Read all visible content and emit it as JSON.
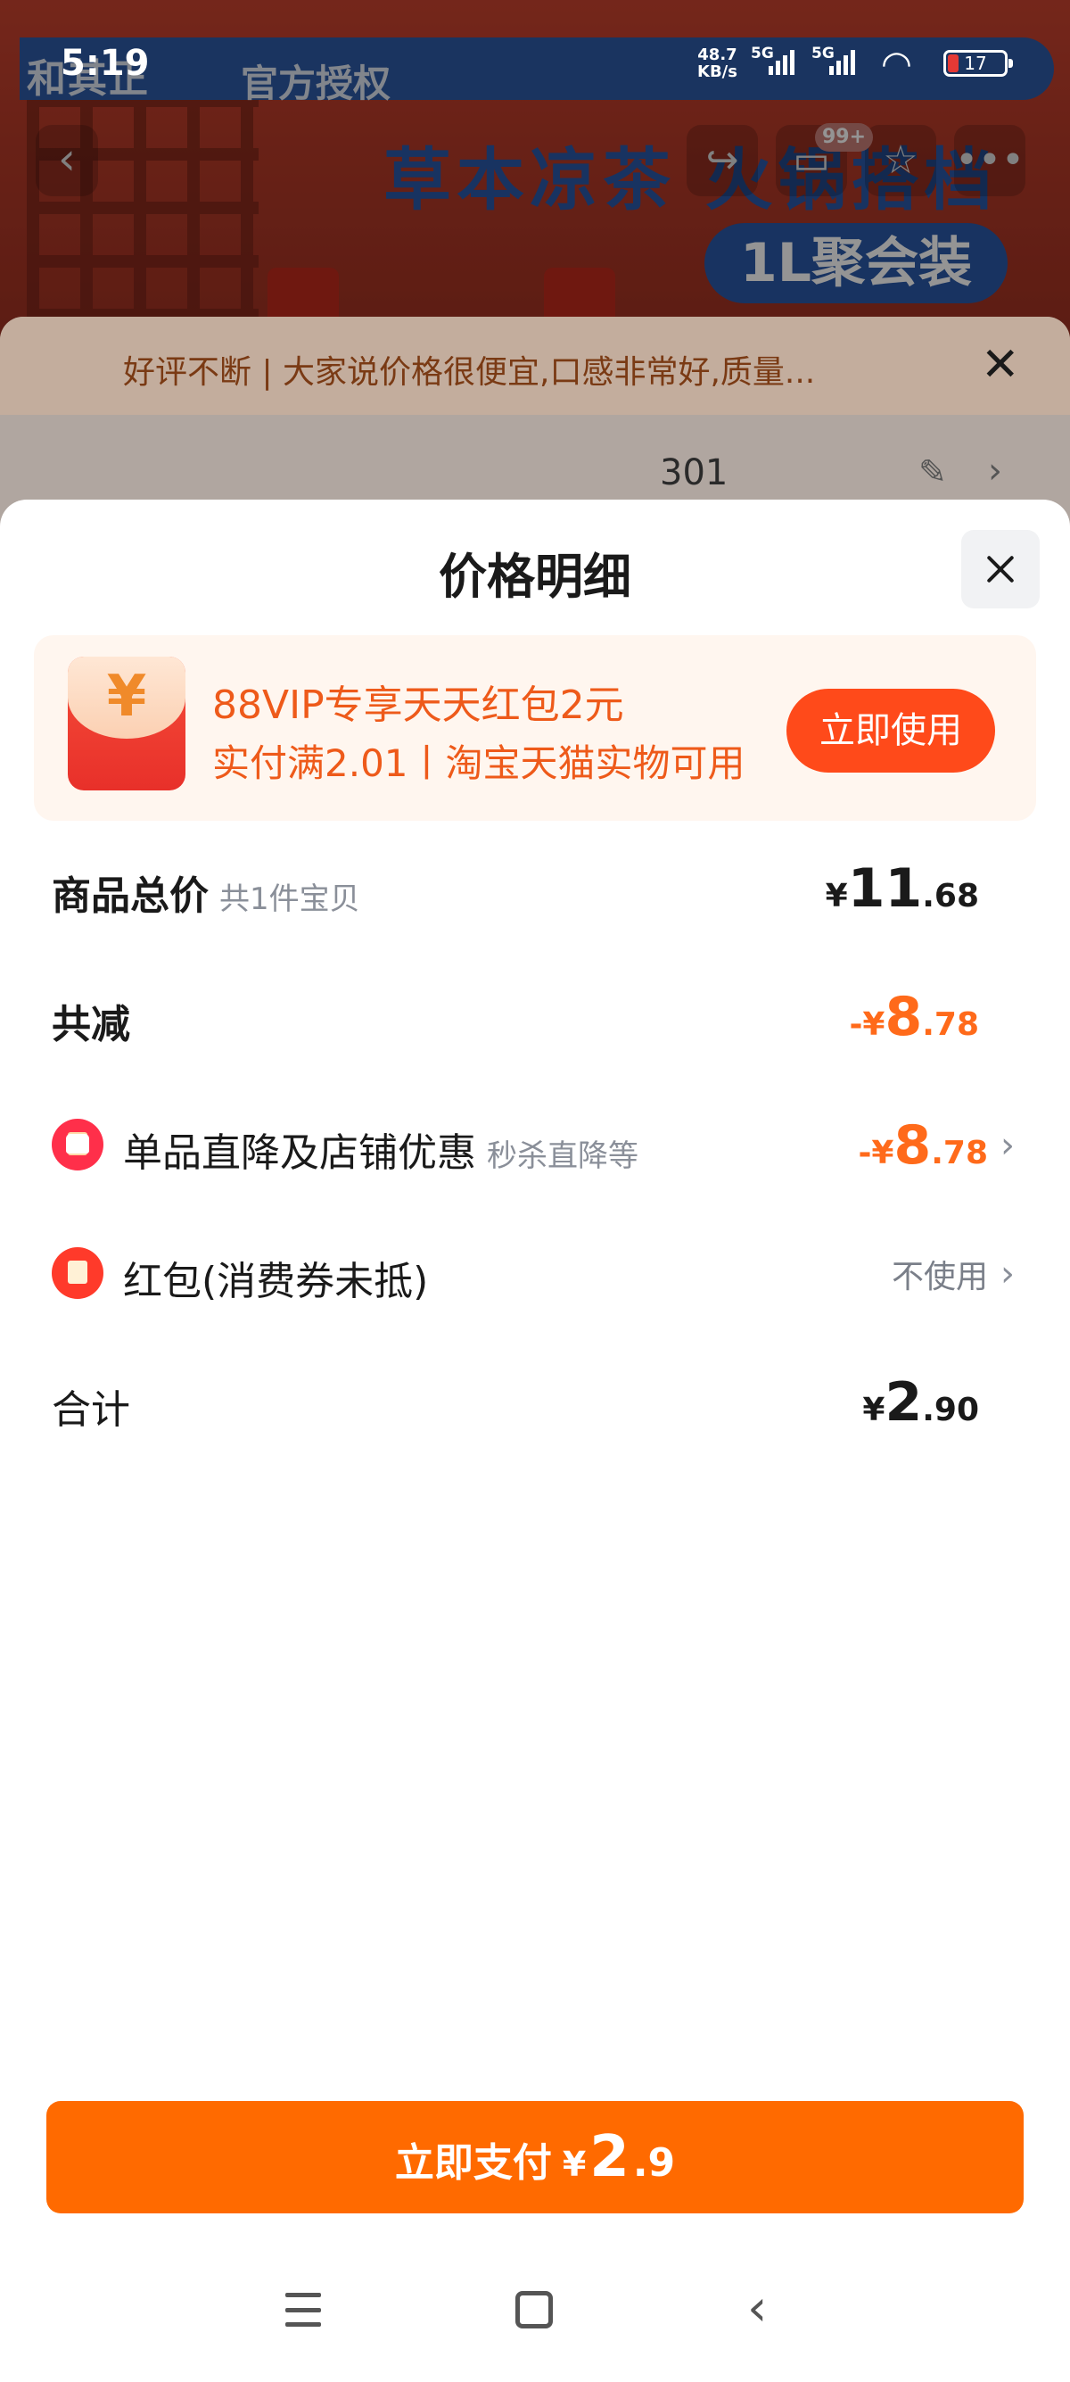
{
  "status_bar": {
    "time": "5:19",
    "net_speed": "48.7",
    "net_unit": "KB/s",
    "sig1": "5G",
    "sig2": "5G",
    "battery": "17"
  },
  "background": {
    "brand": "和其正",
    "brand_sub": "官方授权",
    "promo_title": "草本凉茶 火锅搭档",
    "promo_pill": "1L聚会装",
    "cart_badge": "99+",
    "notice": "好评不断 | 大家说价格很便宜,口感非常好,质量...",
    "address_fragment": "301"
  },
  "sheet": {
    "title": "价格明细",
    "vip_card": {
      "line1": "88VIP专享天天红包2元",
      "line2": "实付满2.01丨淘宝天猫实物可用",
      "button": "立即使用"
    },
    "rows": {
      "total": {
        "label": "商品总价",
        "sub": "共1件宝贝",
        "cur": "¥",
        "int": "11",
        "dec": ".68"
      },
      "reduce": {
        "label": "共减",
        "cur": "-¥",
        "int": "8",
        "dec": ".78"
      },
      "discount": {
        "label": "单品直降及店铺优惠",
        "sub": "秒杀直降等",
        "cur": "-¥",
        "int": "8",
        "dec": ".78"
      },
      "redpacket": {
        "label": "红包(消费券未抵)",
        "value": "不使用"
      },
      "sum": {
        "label": "合计",
        "cur": "¥",
        "int": "2",
        "dec": ".90"
      }
    },
    "pay_button": {
      "label": "立即支付",
      "cur": "¥",
      "int": "2",
      "dec": ".9"
    }
  },
  "colors": {
    "accent_orange": "#ff6a00",
    "discount_orange": "#ff6a1a",
    "vip_red": "#ff4a1a",
    "icon_red": "#ff2f4a"
  },
  "icons": [
    "close-icon",
    "red-packet-icon",
    "shop-discount-icon",
    "chevron-right-icon",
    "menu-icon",
    "home-icon",
    "back-icon",
    "wifi-icon",
    "battery-icon",
    "signal-icon"
  ]
}
